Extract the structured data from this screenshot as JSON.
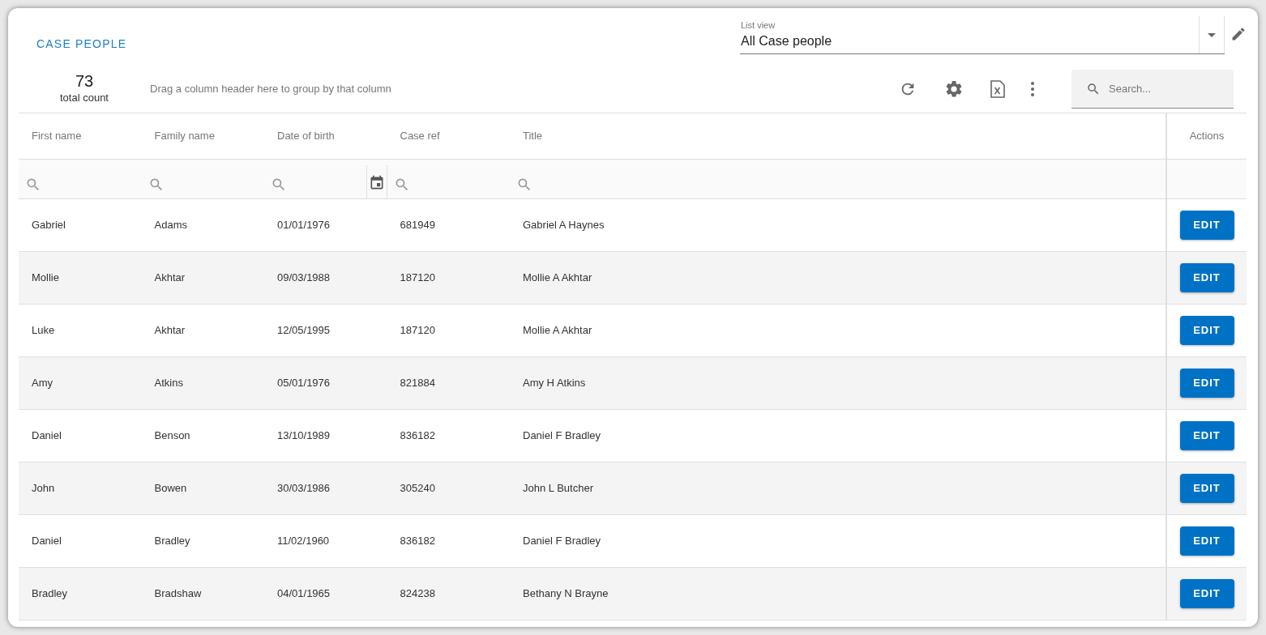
{
  "title": "CASE PEOPLE",
  "list_view": {
    "label": "List view",
    "value": "All Case people"
  },
  "total": {
    "count": "73",
    "label": "total count"
  },
  "group_hint": "Drag a column header here to group by that column",
  "search": {
    "placeholder": "Search..."
  },
  "table": {
    "columns": [
      {
        "label": "First name",
        "kind": "text"
      },
      {
        "label": "Family name",
        "kind": "text"
      },
      {
        "label": "Date of birth",
        "kind": "date"
      },
      {
        "label": "Case ref",
        "kind": "text"
      },
      {
        "label": "Title",
        "kind": "text"
      }
    ],
    "actions_label": "Actions",
    "rows": [
      {
        "cells": [
          "Gabriel",
          "Adams",
          "01/01/1976",
          "681949",
          "Gabriel A Haynes"
        ],
        "action": "EDIT"
      },
      {
        "cells": [
          "Mollie",
          "Akhtar",
          "09/03/1988",
          "187120",
          "Mollie A Akhtar"
        ],
        "action": "EDIT"
      },
      {
        "cells": [
          "Luke",
          "Akhtar",
          "12/05/1995",
          "187120",
          "Mollie A Akhtar"
        ],
        "action": "EDIT"
      },
      {
        "cells": [
          "Amy",
          "Atkins",
          "05/01/1976",
          "821884",
          "Amy H Atkins"
        ],
        "action": "EDIT"
      },
      {
        "cells": [
          "Daniel",
          "Benson",
          "13/10/1989",
          "836182",
          "Daniel F Bradley"
        ],
        "action": "EDIT"
      },
      {
        "cells": [
          "John",
          "Bowen",
          "30/03/1986",
          "305240",
          "John L Butcher"
        ],
        "action": "EDIT"
      },
      {
        "cells": [
          "Daniel",
          "Bradley",
          "11/02/1960",
          "836182",
          "Daniel F Bradley"
        ],
        "action": "EDIT"
      },
      {
        "cells": [
          "Bradley",
          "Bradshaw",
          "04/01/1965",
          "824238",
          "Bethany N Brayne"
        ],
        "action": "EDIT"
      }
    ]
  }
}
